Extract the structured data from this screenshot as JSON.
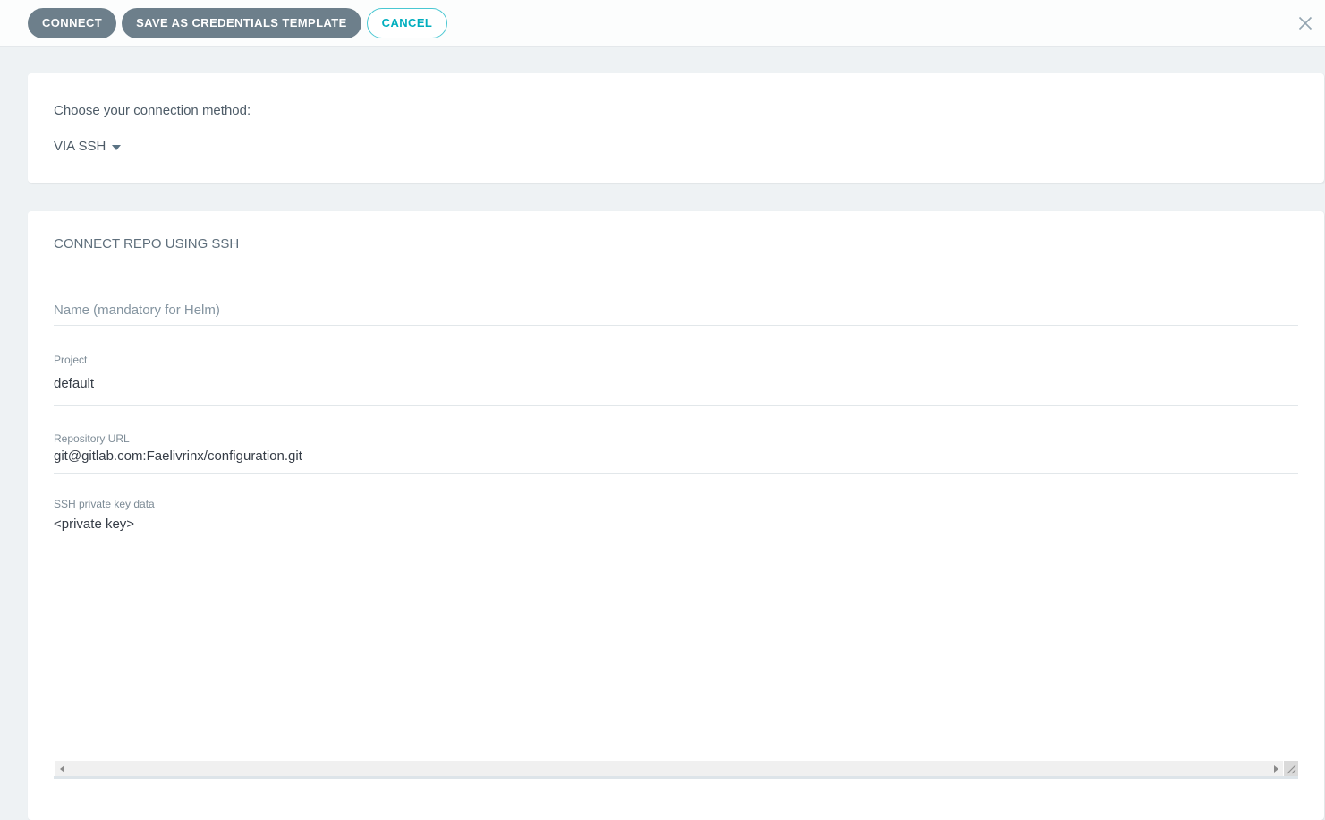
{
  "toolbar": {
    "connect": "CONNECT",
    "save_as_credentials_template": "SAVE AS CREDENTIALS TEMPLATE",
    "cancel": "CANCEL"
  },
  "method_panel": {
    "prompt": "Choose your connection method:",
    "selected_method": "VIA SSH"
  },
  "form_panel": {
    "heading": "CONNECT REPO USING SSH",
    "fields": {
      "name": {
        "placeholder": "Name (mandatory for Helm)",
        "value": ""
      },
      "project": {
        "label": "Project",
        "value": "default"
      },
      "repo_url": {
        "label": "Repository URL",
        "value": "git@gitlab.com:Faelivrinx/configuration.git"
      },
      "ssh_key": {
        "label": "SSH private key data",
        "value": "<private key>"
      }
    }
  },
  "icons": {
    "close": "close-icon",
    "caret_down": "caret-down-icon",
    "scroll_left_arrow": "scroll-left-arrow-icon",
    "scroll_right_arrow": "scroll-right-arrow-icon",
    "resize_grip": "resize-grip-icon"
  },
  "colors": {
    "page_bg": "#eef2f4",
    "topbar_bg": "#fcfdfd",
    "button_slate": "#6d7f8b",
    "accent_teal": "#00aebe",
    "teal_border": "#49c7d2",
    "text_primary": "#363d47",
    "text_slate": "#4d5b67",
    "heading_gray": "#5f6f7c",
    "label_muted": "#7d8b96",
    "placeholder_gray": "#8494a0",
    "field_underline": "#e2e7ea",
    "textarea_underline": "#dde4e9",
    "scrollbar_track": "#f0f0f0"
  }
}
